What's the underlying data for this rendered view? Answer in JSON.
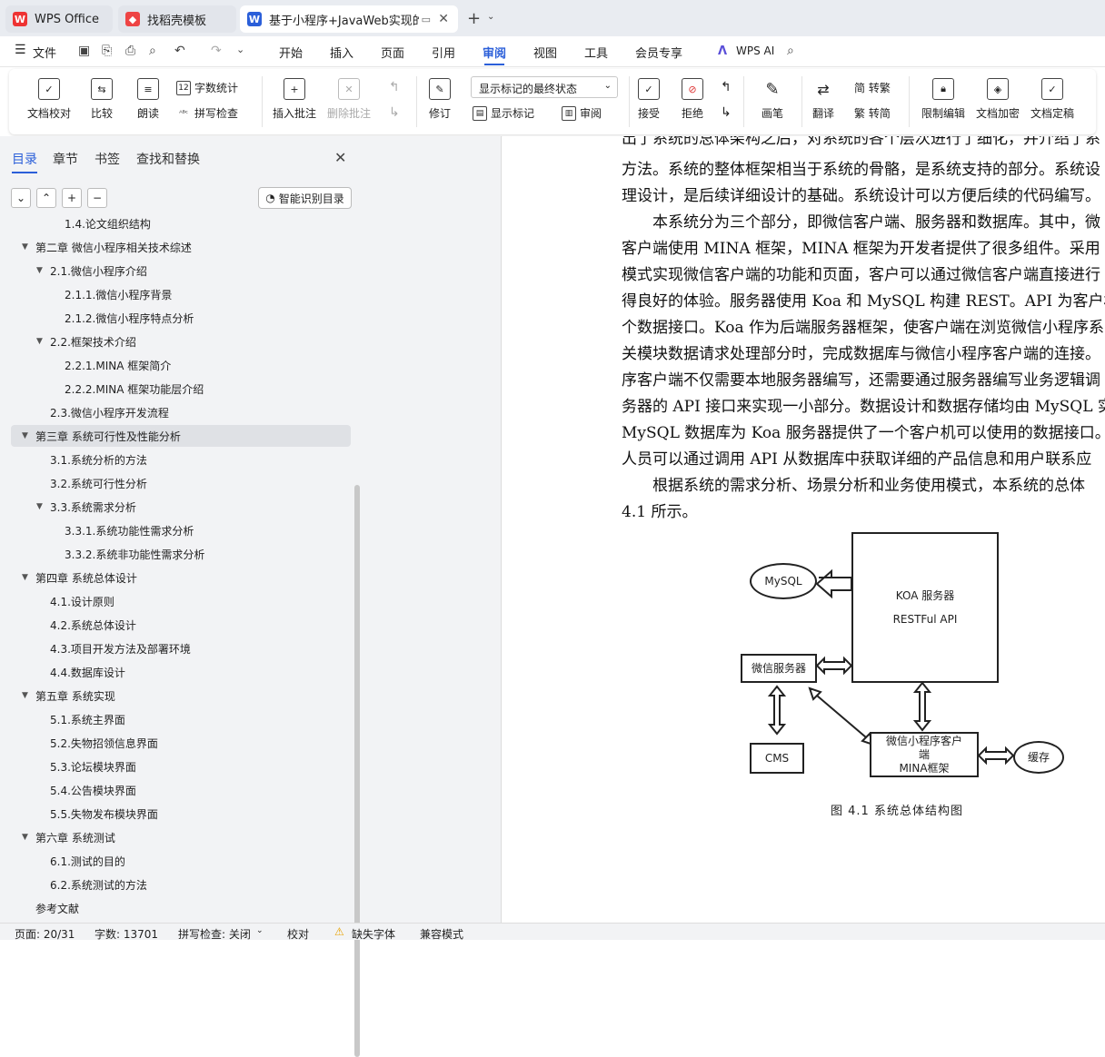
{
  "tabs": [
    {
      "label": "WPS Office"
    },
    {
      "label": "找稻壳模板"
    },
    {
      "label": "基于小程序+JavaWeb实现的"
    }
  ],
  "menubar": {
    "file": "文件",
    "items": [
      "开始",
      "插入",
      "页面",
      "引用",
      "审阅",
      "视图",
      "工具",
      "会员专享"
    ],
    "active": "审阅",
    "ai": "WPS AI"
  },
  "ribbon": {
    "doc_proof": "文档校对",
    "compare": "比较",
    "read_aloud": "朗读",
    "word_count": "字数统计",
    "spell_check": "拼写检查",
    "insert_comment": "插入批注",
    "delete_comment": "删除批注",
    "track": "修订",
    "markup_state": "显示标记的最终状态",
    "show_markup": "显示标记",
    "review": "审阅",
    "accept": "接受",
    "reject": "拒绝",
    "pen": "画笔",
    "translate": "翻译",
    "to_trad": "简 转繁",
    "to_simp": "繁 转简",
    "restrict": "限制编辑",
    "encrypt": "文档加密",
    "finalize": "文档定稿"
  },
  "sidebar": {
    "tabs": [
      "目录",
      "章节",
      "书签",
      "查找和替换"
    ],
    "smart_btn": "智能识别目录",
    "toc": [
      {
        "label": "1.4.论文组织结构",
        "level": 3
      },
      {
        "label": "第二章 微信小程序相关技术综述",
        "level": 1,
        "arrow": "▼"
      },
      {
        "label": "2.1.微信小程序介绍",
        "level": 2,
        "arrow": "▼"
      },
      {
        "label": "2.1.1.微信小程序背景",
        "level": 3
      },
      {
        "label": "2.1.2.微信小程序特点分析",
        "level": 3
      },
      {
        "label": "2.2.框架技术介绍",
        "level": 2,
        "arrow": "▼"
      },
      {
        "label": "2.2.1.MINA 框架简介",
        "level": 3
      },
      {
        "label": "2.2.2.MINA 框架功能层介绍",
        "level": 3
      },
      {
        "label": "2.3.微信小程序开发流程",
        "level": 2
      },
      {
        "label": "第三章 系统可行性及性能分析",
        "level": 1,
        "arrow": "▼",
        "selected": true
      },
      {
        "label": "3.1.系统分析的方法",
        "level": 2
      },
      {
        "label": "3.2.系统可行性分析",
        "level": 2
      },
      {
        "label": "3.3.系统需求分析",
        "level": 2,
        "arrow": "▼"
      },
      {
        "label": "3.3.1.系统功能性需求分析",
        "level": 3
      },
      {
        "label": "3.3.2.系统非功能性需求分析",
        "level": 3
      },
      {
        "label": "第四章 系统总体设计",
        "level": 1,
        "arrow": "▼"
      },
      {
        "label": "4.1.设计原则",
        "level": 2
      },
      {
        "label": "4.2.系统总体设计",
        "level": 2
      },
      {
        "label": "4.3.项目开发方法及部署环境",
        "level": 2
      },
      {
        "label": "4.4.数据库设计",
        "level": 2
      },
      {
        "label": "第五章 系统实现",
        "level": 1,
        "arrow": "▼"
      },
      {
        "label": "5.1.系统主界面",
        "level": 2
      },
      {
        "label": "5.2.失物招领信息界面",
        "level": 2
      },
      {
        "label": "5.3.论坛模块界面",
        "level": 2
      },
      {
        "label": "5.4.公告模块界面",
        "level": 2
      },
      {
        "label": "5.5.失物发布模块界面",
        "level": 2
      },
      {
        "label": "第六章 系统测试",
        "level": 1,
        "arrow": "▼"
      },
      {
        "label": "6.1.测试的目的",
        "level": 2
      },
      {
        "label": "6.2.系统测试的方法",
        "level": 2
      },
      {
        "label": "参考文献",
        "level": 1
      }
    ]
  },
  "document": {
    "lines": [
      "出了系统的总体架构之后，对系统的各个层次进行了细化，并介绍了系",
      "方法。系统的整体框架相当于系统的骨骼，是系统支持的部分。系统设",
      "理设计，是后续详细设计的基础。系统设计可以方便后续的代码编写。",
      "　　本系统分为三个部分，即微信客户端、服务器和数据库。其中，微",
      "客户端使用 MINA 框架，MINA 框架为开发者提供了很多组件。采用",
      "模式实现微信客户端的功能和页面，客户可以通过微信客户端直接进行",
      "得良好的体验。服务器使用 Koa 和 MySQL 构建 REST。API 为客户机",
      "个数据接口。Koa 作为后端服务器框架，使客户端在浏览微信小程序系",
      "关模块数据请求处理部分时，完成数据库与微信小程序客户端的连接。",
      "序客户端不仅需要本地服务器编写，还需要通过服务器编写业务逻辑调",
      "务器的 API 接口来实现一小部分。数据设计和数据存储均由 MySQL 实",
      "MySQL 数据库为 Koa 服务器提供了一个客户机可以使用的数据接口。",
      "人员可以通过调用 API 从数据库中获取详细的产品信息和用户联系应",
      "　　根据系统的需求分析、场景分析和业务使用模式，本系统的总体",
      "4.1 所示。"
    ],
    "diagram": {
      "mysql": "MySQL",
      "koa_line1": "KOA 服务器",
      "koa_line2": "RESTFul API",
      "wechat_server": "微信服务器",
      "cms": "CMS",
      "client_line1": "微信小程序客户",
      "client_line2": "端",
      "client_line3": "MINA框架",
      "cache": "缓存"
    },
    "caption": "图 4.1  系统总体结构图"
  },
  "status": {
    "page": "页面: 20/31",
    "words": "字数: 13701",
    "spell": "拼写检查: 关闭",
    "proof": "校对",
    "missing_font": "缺失字体",
    "compat": "兼容模式"
  }
}
